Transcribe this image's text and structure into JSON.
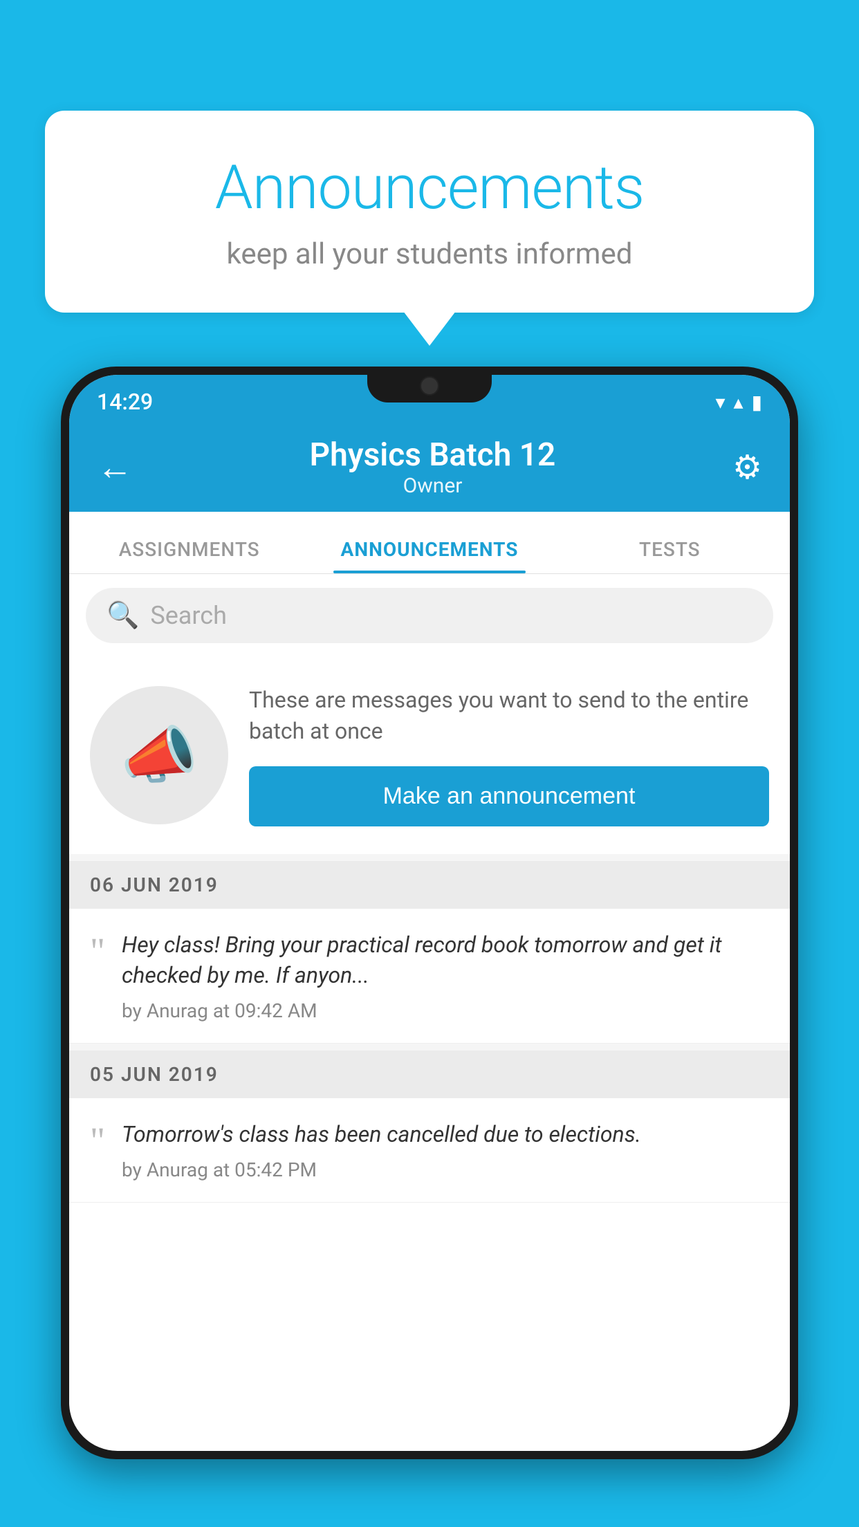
{
  "background_color": "#1ab8e8",
  "speech_bubble": {
    "title": "Announcements",
    "subtitle": "keep all your students informed"
  },
  "status_bar": {
    "time": "14:29",
    "wifi": "▼",
    "signal": "▲",
    "battery": "▌"
  },
  "header": {
    "title": "Physics Batch 12",
    "subtitle": "Owner",
    "back_label": "←",
    "settings_label": "⚙"
  },
  "tabs": [
    {
      "label": "ASSIGNMENTS",
      "active": false
    },
    {
      "label": "ANNOUNCEMENTS",
      "active": true
    },
    {
      "label": "TESTS",
      "active": false
    }
  ],
  "search": {
    "placeholder": "Search"
  },
  "promo": {
    "description": "These are messages you want to send to the entire batch at once",
    "button_label": "Make an announcement"
  },
  "announcements": [
    {
      "date": "06  JUN  2019",
      "text": "Hey class! Bring your practical record book tomorrow and get it checked by me. If anyon...",
      "meta": "by Anurag at 09:42 AM"
    },
    {
      "date": "05  JUN  2019",
      "text": "Tomorrow's class has been cancelled due to elections.",
      "meta": "by Anurag at 05:42 PM"
    }
  ]
}
